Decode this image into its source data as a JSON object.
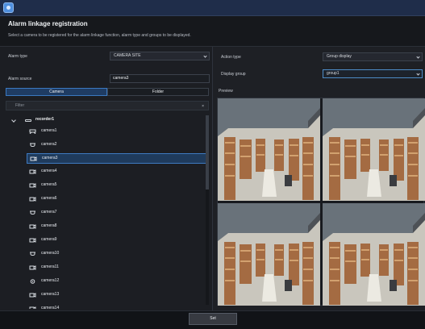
{
  "window": {
    "dialog_title": "Alarm linkage registration",
    "instruction": "Select a camera to be registered for the alarm linkage function, alarm type and groups to be displayed."
  },
  "left": {
    "alarm_type_label": "Alarm type",
    "alarm_type_value": "CAMERA SITE",
    "alarm_source_label": "Alarm source",
    "alarm_source_value": "camera3",
    "tabs": [
      "Camera",
      "Folder"
    ],
    "filter_placeholder": "Filter",
    "filter_clear": "×",
    "recorder": "recorder1",
    "cameras": [
      "camera1",
      "camera2",
      "camera3",
      "camera4",
      "camera5",
      "camera6",
      "camera7",
      "camera8",
      "camera9",
      "camera10",
      "camera11",
      "camera12",
      "camera13",
      "camera14"
    ],
    "selected_camera": "camera3"
  },
  "right": {
    "action_type_label": "Action type",
    "action_type_value": "Group display",
    "display_group_label": "Display group",
    "display_group_value": "group1",
    "preview_label": "Preview"
  },
  "footer": {
    "set_label": "Set"
  },
  "icons": {
    "app": "app-icon",
    "tree_toggle": "chevron-down-icon",
    "recorder": "recorder-icon",
    "camera": "camera-icon",
    "dropdown": "chevron-down-icon"
  },
  "colors": {
    "accent": "#3b78bf",
    "selection": "#1f3b5c",
    "background": "#1b1d22"
  }
}
